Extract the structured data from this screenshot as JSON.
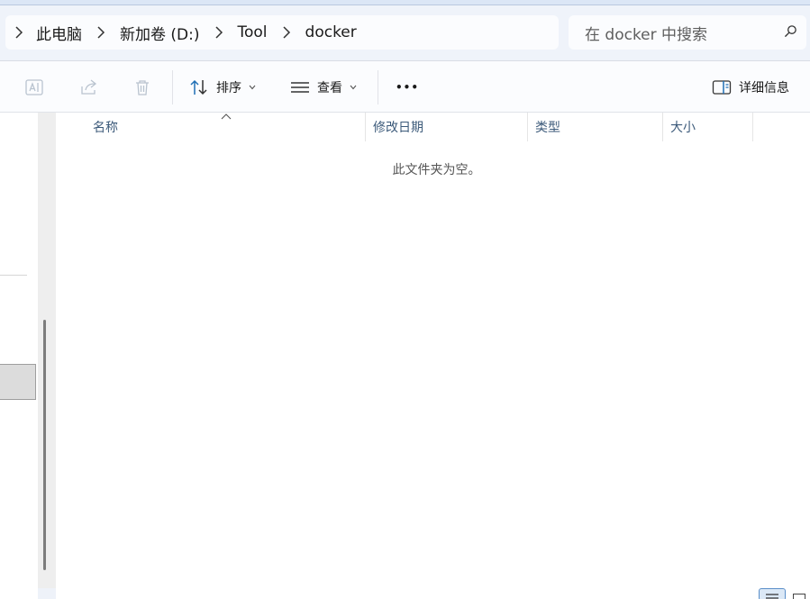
{
  "breadcrumb": {
    "items": [
      "此电脑",
      "新加卷 (D:)",
      "Tool",
      "docker"
    ]
  },
  "search": {
    "placeholder": "在 docker 中搜索"
  },
  "toolbar": {
    "rename_icon": "rename-icon",
    "share_icon": "share-icon",
    "delete_icon": "trash-icon",
    "sort_label": "排序",
    "view_label": "查看",
    "more_label": "•••",
    "details_label": "详细信息"
  },
  "columns": {
    "name": "名称",
    "modified": "修改日期",
    "type": "类型",
    "size": "大小"
  },
  "empty_message": "此文件夹为空。",
  "colors": {
    "accent": "#1f6fb5",
    "header_text": "#3c5a7a",
    "chrome_bg": "#eff3fa"
  }
}
